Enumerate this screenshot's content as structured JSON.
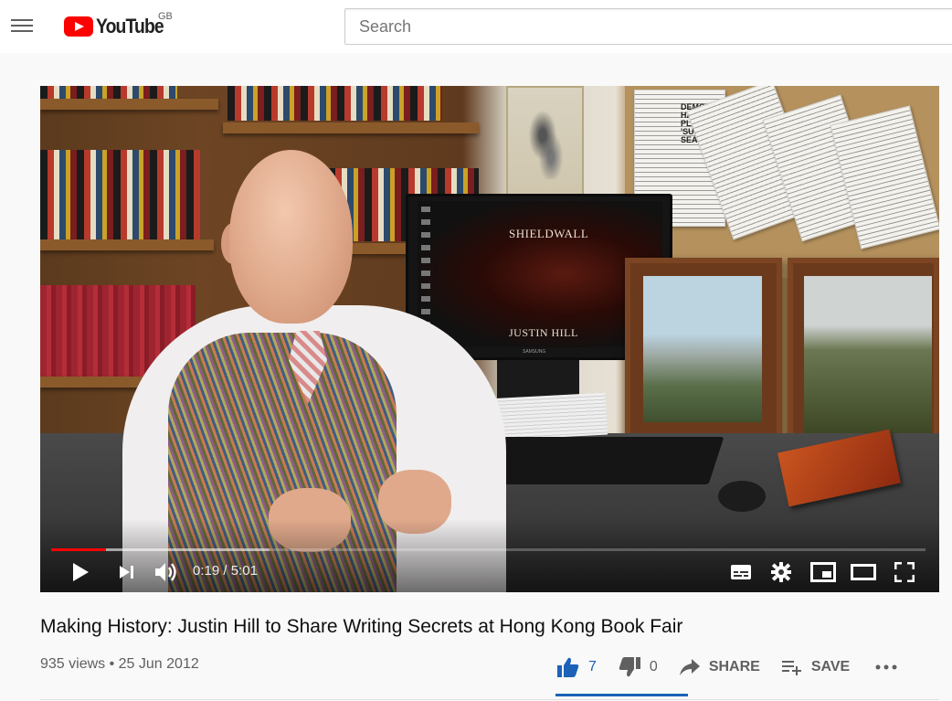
{
  "masthead": {
    "logo_text": "YouTube",
    "region": "GB",
    "search_placeholder": "Search"
  },
  "player": {
    "screen_title": "SHIELDWALL",
    "screen_author": "JUSTIN HILL",
    "monitor_brand": "SAMSUNG",
    "news_headline": "DEMOCRATS HAVE PLAN FOR 'SUPER SEATS'",
    "current_time": "0:19",
    "separator": " / ",
    "duration": "5:01",
    "played_fraction": 0.063,
    "buffered_fraction": 0.25
  },
  "video": {
    "title": "Making History: Justin Hill to Share Writing Secrets at Hong Kong Book Fair",
    "views": "935 views",
    "dot": " • ",
    "date": "25 Jun 2012"
  },
  "actions": {
    "likes": "7",
    "dislikes": "0",
    "share_label": "SHARE",
    "save_label": "SAVE",
    "like_ratio": 1.0
  },
  "colors": {
    "brand_red": "#ff0000",
    "like_blue": "#1c62b9",
    "text_secondary": "#606060"
  }
}
